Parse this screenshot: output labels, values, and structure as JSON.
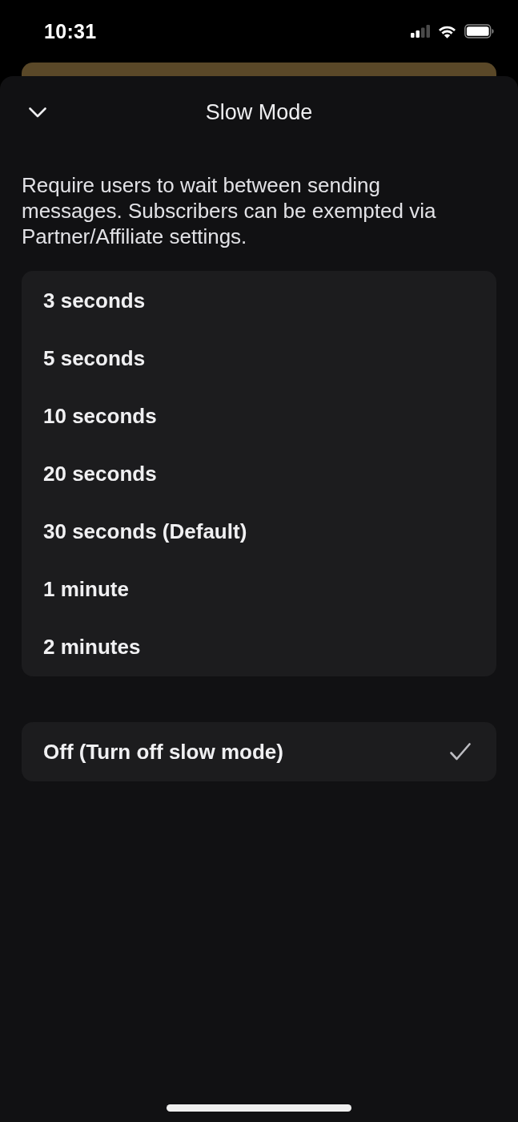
{
  "status_bar": {
    "time": "10:31"
  },
  "sheet": {
    "title": "Slow Mode",
    "description": "Require users to wait between sending messages. Subscribers can be exempted via Partner/Affiliate settings."
  },
  "option_groups": [
    {
      "options": [
        {
          "label": "3 seconds",
          "selected": false
        },
        {
          "label": "5 seconds",
          "selected": false
        },
        {
          "label": "10 seconds",
          "selected": false
        },
        {
          "label": "20 seconds",
          "selected": false
        },
        {
          "label": "30 seconds (Default)",
          "selected": false
        },
        {
          "label": "1 minute",
          "selected": false
        },
        {
          "label": "2 minutes",
          "selected": false
        }
      ]
    },
    {
      "options": [
        {
          "label": "Off (Turn off slow mode)",
          "selected": true
        }
      ]
    }
  ]
}
